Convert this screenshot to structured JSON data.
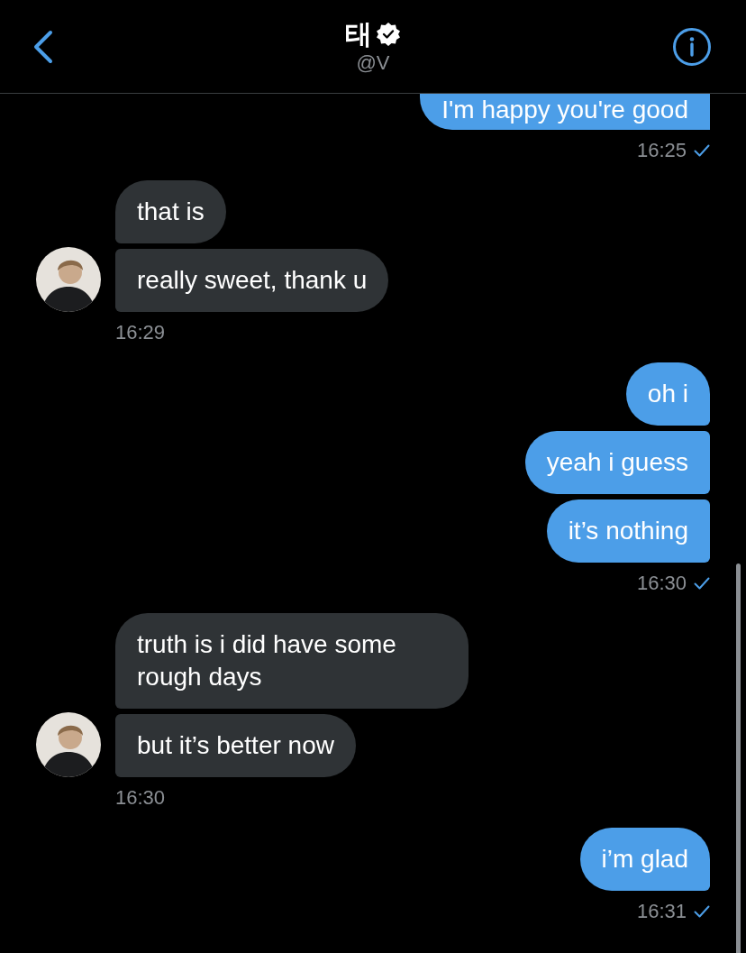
{
  "header": {
    "title": "태",
    "verified": true,
    "handle": "@V"
  },
  "groups": [
    {
      "kind": "sent",
      "messages": [
        "I'm happy you're good"
      ],
      "time": "16:25",
      "read": true
    },
    {
      "kind": "received",
      "messages": [
        "that is",
        "really sweet, thank u"
      ],
      "time": "16:29"
    },
    {
      "kind": "sent",
      "messages": [
        "oh i",
        "yeah i guess",
        "it’s nothing"
      ],
      "time": "16:30",
      "read": true
    },
    {
      "kind": "received",
      "messages": [
        "truth is i did have some rough days",
        "but it’s better now"
      ],
      "time": "16:30"
    },
    {
      "kind": "sent",
      "messages": [
        "i’m glad"
      ],
      "time": "16:31",
      "read": true
    }
  ]
}
